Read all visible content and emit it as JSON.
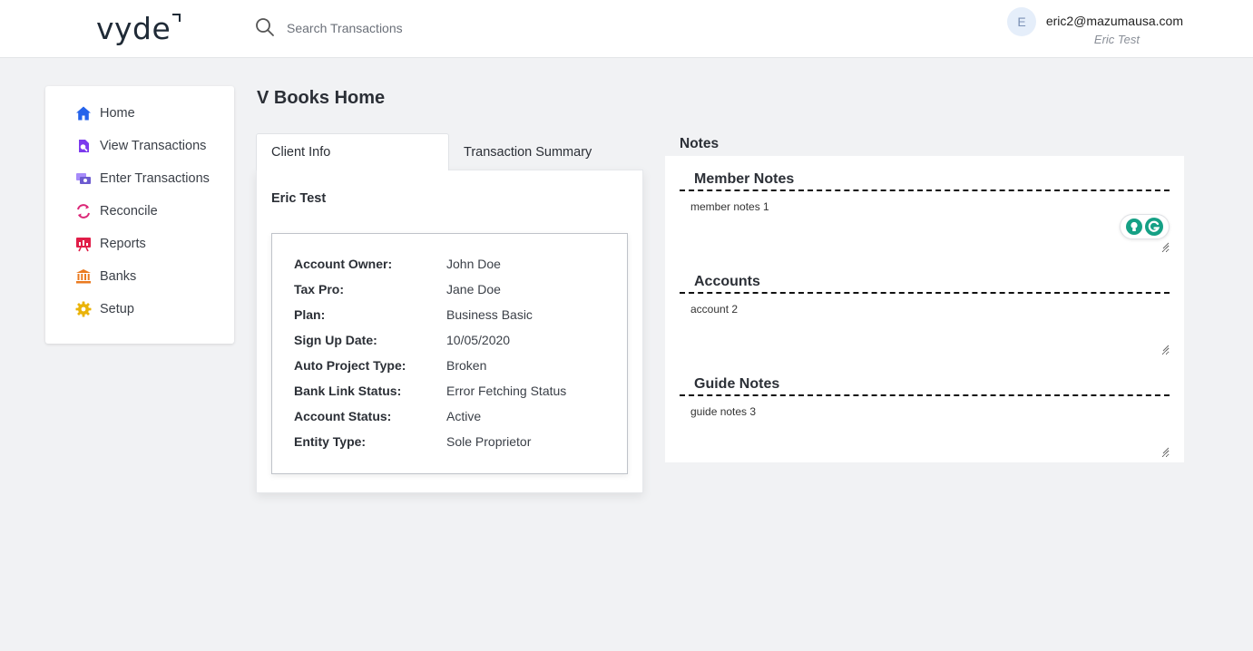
{
  "header": {
    "logo": "vyde",
    "search_placeholder": "Search Transactions",
    "user": {
      "avatar_initial": "E",
      "email": "eric2@mazumausa.com",
      "name": "Eric Test"
    }
  },
  "sidebar": {
    "items": [
      {
        "label": "Home",
        "icon": "home-icon",
        "color": "#2563eb"
      },
      {
        "label": "View Transactions",
        "icon": "view-transactions-icon",
        "color": "#7c3aed"
      },
      {
        "label": "Enter Transactions",
        "icon": "enter-transactions-icon",
        "color": "#6d5bd0"
      },
      {
        "label": "Reconcile",
        "icon": "reconcile-icon",
        "color": "#db2777"
      },
      {
        "label": "Reports",
        "icon": "reports-icon",
        "color": "#e11d48"
      },
      {
        "label": "Banks",
        "icon": "bank-icon",
        "color": "#ea7a1f"
      },
      {
        "label": "Setup",
        "icon": "gear-icon",
        "color": "#eab308"
      }
    ]
  },
  "page": {
    "title": "V Books Home"
  },
  "tabs": [
    {
      "label": "Client Info",
      "active": true
    },
    {
      "label": "Transaction Summary",
      "active": false
    }
  ],
  "client": {
    "name": "Eric Test",
    "fields": [
      {
        "key": "Account Owner:",
        "value": "John Doe"
      },
      {
        "key": "Tax Pro:",
        "value": "Jane Doe"
      },
      {
        "key": "Plan:",
        "value": "Business Basic"
      },
      {
        "key": "Sign Up Date:",
        "value": "10/05/2020"
      },
      {
        "key": "Auto Project Type:",
        "value": "Broken"
      },
      {
        "key": "Bank Link Status:",
        "value": "Error Fetching Status"
      },
      {
        "key": "Account Status:",
        "value": "Active"
      },
      {
        "key": "Entity Type:",
        "value": "Sole Proprietor"
      }
    ]
  },
  "notes": {
    "title": "Notes",
    "sections": [
      {
        "heading": "Member Notes",
        "text": "member notes 1"
      },
      {
        "heading": "Accounts",
        "text": "account 2"
      },
      {
        "heading": "Guide Notes",
        "text": "guide notes 3"
      }
    ]
  },
  "colors": {
    "background": "#f1f2f4",
    "panel": "#ffffff",
    "grammarly": "#15a085"
  }
}
